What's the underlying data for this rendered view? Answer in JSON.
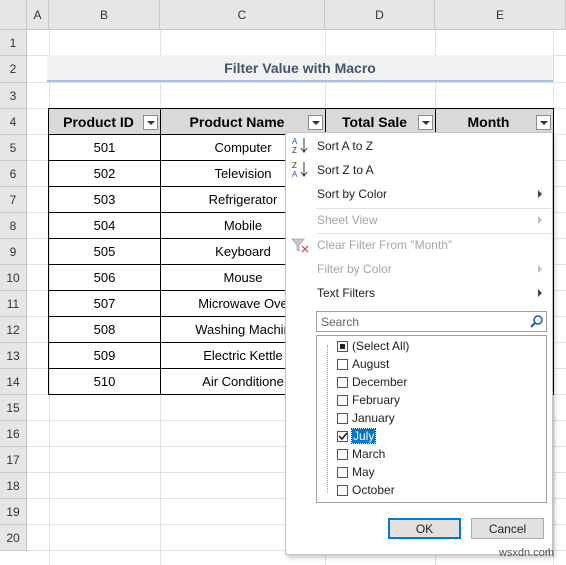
{
  "columns": [
    "A",
    "B",
    "C",
    "D",
    "E"
  ],
  "rows": [
    "1",
    "2",
    "3",
    "4",
    "5",
    "6",
    "7",
    "8",
    "9",
    "10",
    "11",
    "12",
    "13",
    "14",
    "15",
    "16",
    "17",
    "18",
    "19",
    "20"
  ],
  "title": "Filter Value with Macro",
  "table": {
    "headers": [
      "Product ID",
      "Product Name",
      "Total Sale",
      "Month"
    ],
    "rows": [
      {
        "id": "501",
        "name": "Computer"
      },
      {
        "id": "502",
        "name": "Television"
      },
      {
        "id": "503",
        "name": "Refrigerator"
      },
      {
        "id": "504",
        "name": "Mobile"
      },
      {
        "id": "505",
        "name": "Keyboard"
      },
      {
        "id": "506",
        "name": "Mouse"
      },
      {
        "id": "507",
        "name": "Microwave Ove"
      },
      {
        "id": "508",
        "name": "Washing Machin"
      },
      {
        "id": "509",
        "name": "Electric Kettle"
      },
      {
        "id": "510",
        "name": "Air Conditione"
      }
    ]
  },
  "menu": {
    "sort_az": "Sort A to Z",
    "sort_za": "Sort Z to A",
    "sort_color": "Sort by Color",
    "sheet_view": "Sheet View",
    "clear_filter": "Clear Filter From \"Month\"",
    "filter_color": "Filter by Color",
    "text_filters": "Text Filters",
    "search_placeholder": "Search",
    "items": [
      {
        "label": "(Select All)",
        "state": "partial"
      },
      {
        "label": "August",
        "state": "unchecked"
      },
      {
        "label": "December",
        "state": "unchecked"
      },
      {
        "label": "February",
        "state": "unchecked"
      },
      {
        "label": "January",
        "state": "unchecked"
      },
      {
        "label": "July",
        "state": "checked"
      },
      {
        "label": "March",
        "state": "unchecked"
      },
      {
        "label": "May",
        "state": "unchecked"
      },
      {
        "label": "October",
        "state": "unchecked"
      }
    ],
    "ok": "OK",
    "cancel": "Cancel"
  },
  "watermark": "wsxdn.com"
}
